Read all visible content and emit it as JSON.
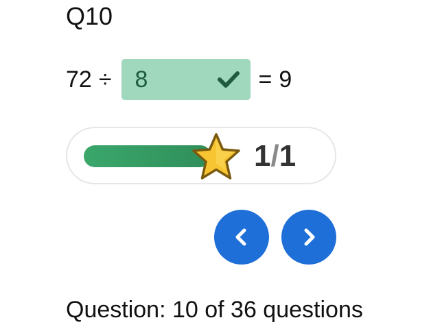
{
  "question": {
    "title": "Q10",
    "dividend": "72",
    "operator": "÷",
    "answer_value": "8",
    "equals": "=",
    "result": "9",
    "answer_correct": true
  },
  "progress": {
    "correct": "1",
    "separator": "/",
    "total": "1",
    "fill_fraction": 1.0,
    "star_icon": "star-icon"
  },
  "navigation": {
    "prev_icon": "chevron-left-icon",
    "next_icon": "chevron-right-icon"
  },
  "status": {
    "text": "Question: 10 of 36 questions"
  },
  "colors": {
    "answer_correct_bg": "#9fd8bd",
    "check_color": "#1f5c3f",
    "progress_fill": "#3aa76b",
    "nav_button": "#1f6fd9",
    "star": "#f7c531"
  }
}
